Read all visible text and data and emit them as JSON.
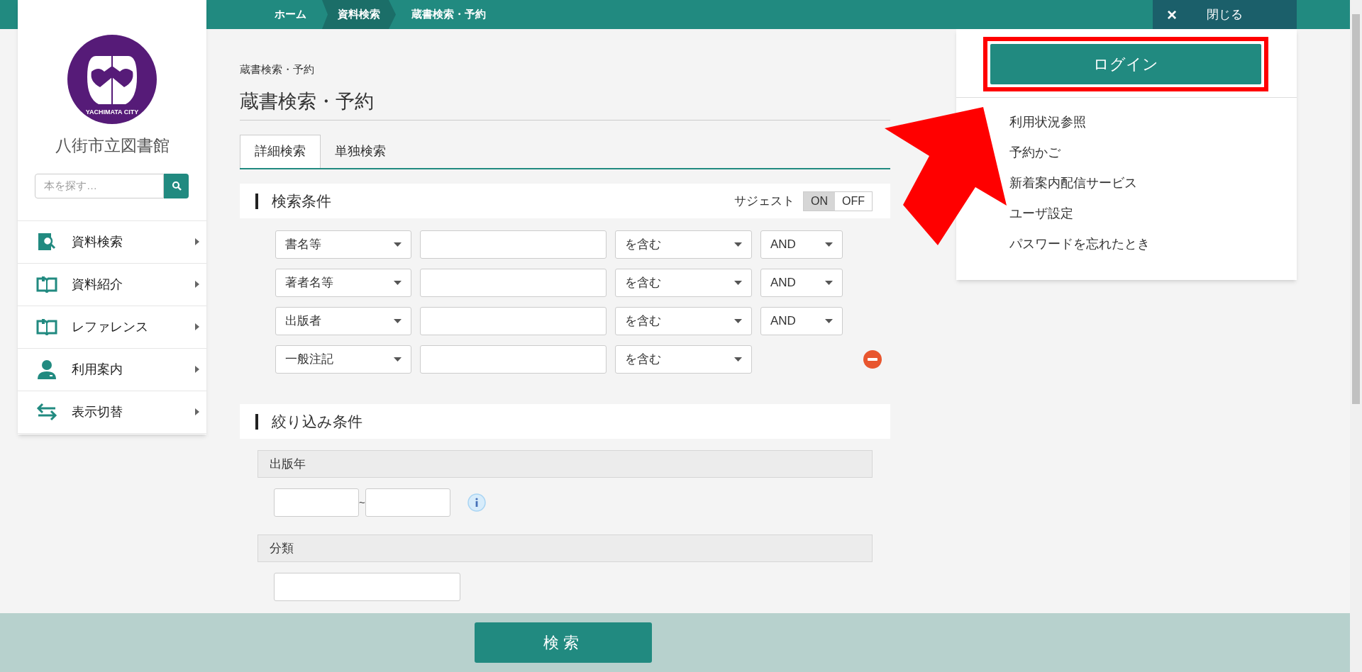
{
  "breadcrumb": [
    {
      "label": "ホーム",
      "selected": false
    },
    {
      "label": "資料検索",
      "selected": true
    },
    {
      "label": "蔵書検索・予約",
      "selected": false
    }
  ],
  "close_button": {
    "icon": "×",
    "label": "閉じる"
  },
  "sidebar": {
    "logo_text": "YACHIMATA CITY",
    "library_name": "八街市立図書館",
    "search": {
      "placeholder": "本を探す…"
    },
    "items": [
      {
        "label": "資料検索",
        "kind": "search"
      },
      {
        "label": "資料紹介",
        "kind": "book"
      },
      {
        "label": "レファレンス",
        "kind": "book"
      },
      {
        "label": "利用案内",
        "kind": "person"
      },
      {
        "label": "表示切替",
        "kind": "switch"
      }
    ]
  },
  "page": {
    "breadcrumb": "蔵書検索・予約",
    "title": "蔵書検索・予約",
    "tabs": [
      {
        "label": "詳細検索",
        "selected": true
      },
      {
        "label": "単独検索",
        "selected": false
      }
    ],
    "conditions": {
      "title": "検索条件",
      "suggest_label": "サジェスト",
      "suggest_on": true,
      "on_label": "ON",
      "off_label": "OFF",
      "rows": [
        {
          "field": "書名等",
          "match": "を含む",
          "operator": "AND",
          "removable": false
        },
        {
          "field": "著者名等",
          "match": "を含む",
          "operator": "AND",
          "removable": false
        },
        {
          "field": "出版者",
          "match": "を含む",
          "operator": "AND",
          "removable": false
        },
        {
          "field": "一般注記",
          "match": "を含む",
          "removable": true
        }
      ]
    },
    "narrowing": {
      "title": "絞り込み条件",
      "year_label": "出版年",
      "range_separator": "~",
      "class_label": "分類"
    },
    "search_button": "検索"
  },
  "user_menu": {
    "login_button": "ログイン",
    "items": [
      "利用状況参照",
      "予約かご",
      "新着案内配信サービス",
      "ユーザ設定",
      "パスワードを忘れたとき"
    ]
  }
}
